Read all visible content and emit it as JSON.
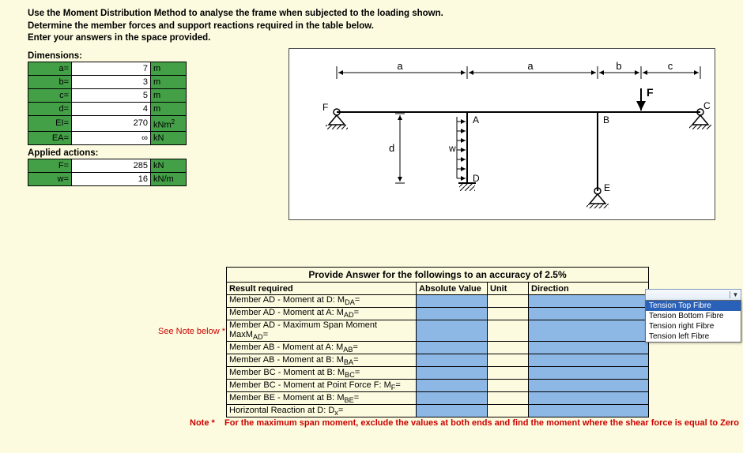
{
  "instructions": {
    "line1": "Use the Moment Distribution Method to analyse the frame when subjected to the loading shown.",
    "line2": "Determine the member forces and support reactions required in the table below.",
    "line3": "Enter your answers in the space provided."
  },
  "dimensions_title": "Dimensions:",
  "dims": [
    {
      "label": "a",
      "val": "7",
      "unit": "m"
    },
    {
      "label": "b",
      "val": "3",
      "unit": "m"
    },
    {
      "label": "c",
      "val": "5",
      "unit": "m"
    },
    {
      "label": "d",
      "val": "4",
      "unit": "m"
    },
    {
      "label": "EI",
      "val": "270",
      "unit": "kNm²"
    },
    {
      "label": "EA",
      "val": "∞",
      "unit": "kN"
    }
  ],
  "actions_title": "Applied actions:",
  "actions": [
    {
      "label": "F",
      "val": "285",
      "unit": "kN"
    },
    {
      "label": "w",
      "val": "16",
      "unit": "kN/m"
    }
  ],
  "diagram": {
    "a": "a",
    "b": "b",
    "c": "c",
    "d": "d",
    "w": "w",
    "F_top": "F",
    "F_left": "F",
    "A": "A",
    "B": "B",
    "C": "C",
    "D": "D",
    "E": "E"
  },
  "answer_caption": "Provide Answer for the followings to an accuracy of 2.5%",
  "headers": {
    "rr": "Result required",
    "av": "Absolute Value",
    "un": "Unit",
    "dir": "Direction"
  },
  "see_note_label": "See Note below *",
  "rows": [
    {
      "d": "Member AD - Moment at D:  M",
      "sub": "DA",
      "eq": "="
    },
    {
      "d": "Member AD - Moment at A: M",
      "sub": "AD",
      "eq": "="
    },
    {
      "d": "Member AD -  Maximum Span Moment MaxM",
      "sub": "AD",
      "eq": "="
    },
    {
      "d": "Member AB - Moment at A:  M",
      "sub": "AB",
      "eq": "="
    },
    {
      "d": "Member AB - Moment at B:  M",
      "sub": "BA",
      "eq": "="
    },
    {
      "d": "Member BC - Moment at B:  M",
      "sub": "BC",
      "eq": "="
    },
    {
      "d": "Member BC - Moment at Point Force F: M",
      "sub": "F",
      "eq": "="
    },
    {
      "d": "Member BE - Moment at B:  M",
      "sub": "BE",
      "eq": "="
    },
    {
      "d": "Horizontal Reaction at D:  D",
      "sub": "x",
      "eq": "="
    }
  ],
  "dropdown": {
    "options": [
      "Tension Top Fibre",
      "Tension Bottom Fibre",
      "Tension right Fibre",
      "Tension left Fibre"
    ],
    "selected_index": 0
  },
  "footnote": {
    "tag": "Note *",
    "text": "For the maximum span moment, exclude the values at both ends and find the moment where the shear force is equal to Zero"
  }
}
